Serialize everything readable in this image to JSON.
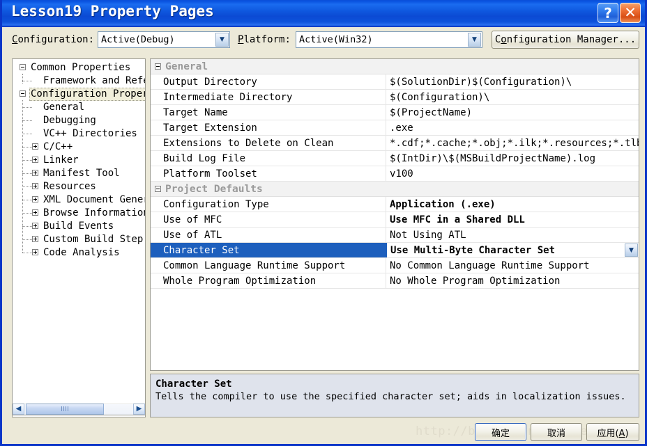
{
  "window": {
    "title": "Lesson19 Property Pages",
    "help_icon": "question-mark-icon",
    "close_icon": "close-x-icon",
    "help_label": "?",
    "close_label": "✕"
  },
  "toolbar": {
    "configuration_label": "Configuration:",
    "configuration_accel": "C",
    "configuration_value": "Active(Debug)",
    "platform_label": "Platform:",
    "platform_accel": "P",
    "platform_value": "Active(Win32)",
    "config_manager_label": "Configuration Manager...",
    "config_manager_accel": "o",
    "dropdown_glyph": "❯"
  },
  "tree": {
    "items": [
      {
        "label": "Common Properties",
        "depth": 0,
        "box": "minus",
        "selected": false
      },
      {
        "label": "Framework and References",
        "depth": 1,
        "box": "none",
        "selected": false
      },
      {
        "label": "Configuration Properties",
        "depth": 0,
        "box": "minus",
        "selected": true
      },
      {
        "label": "General",
        "depth": 1,
        "box": "none",
        "selected": false
      },
      {
        "label": "Debugging",
        "depth": 1,
        "box": "none",
        "selected": false
      },
      {
        "label": "VC++ Directories",
        "depth": 1,
        "box": "none",
        "selected": false
      },
      {
        "label": "C/C++",
        "depth": 1,
        "box": "plus",
        "selected": false
      },
      {
        "label": "Linker",
        "depth": 1,
        "box": "plus",
        "selected": false
      },
      {
        "label": "Manifest Tool",
        "depth": 1,
        "box": "plus",
        "selected": false
      },
      {
        "label": "Resources",
        "depth": 1,
        "box": "plus",
        "selected": false
      },
      {
        "label": "XML Document Generator",
        "depth": 1,
        "box": "plus",
        "selected": false
      },
      {
        "label": "Browse Information",
        "depth": 1,
        "box": "plus",
        "selected": false
      },
      {
        "label": "Build Events",
        "depth": 1,
        "box": "plus",
        "selected": false
      },
      {
        "label": "Custom Build Step",
        "depth": 1,
        "box": "plus",
        "selected": false
      },
      {
        "label": "Code Analysis",
        "depth": 1,
        "box": "plus",
        "selected": false
      }
    ],
    "scrollbar": {
      "left_arrow": "❮",
      "right_arrow": "❯"
    }
  },
  "grid": {
    "sections": [
      {
        "name": "General",
        "collapsed": false,
        "rows": [
          {
            "name": "Output Directory",
            "value": "$(SolutionDir)$(Configuration)\\",
            "bold": false,
            "selected": false
          },
          {
            "name": "Intermediate Directory",
            "value": "$(Configuration)\\",
            "bold": false,
            "selected": false
          },
          {
            "name": "Target Name",
            "value": "$(ProjectName)",
            "bold": false,
            "selected": false
          },
          {
            "name": "Target Extension",
            "value": ".exe",
            "bold": false,
            "selected": false
          },
          {
            "name": "Extensions to Delete on Clean",
            "value": "*.cdf;*.cache;*.obj;*.ilk;*.resources;*.tlb;*",
            "bold": false,
            "selected": false
          },
          {
            "name": "Build Log File",
            "value": "$(IntDir)\\$(MSBuildProjectName).log",
            "bold": false,
            "selected": false
          },
          {
            "name": "Platform Toolset",
            "value": "v100",
            "bold": false,
            "selected": false
          }
        ]
      },
      {
        "name": "Project Defaults",
        "collapsed": false,
        "rows": [
          {
            "name": "Configuration Type",
            "value": "Application (.exe)",
            "bold": true,
            "selected": false
          },
          {
            "name": "Use of MFC",
            "value": "Use MFC in a Shared DLL",
            "bold": true,
            "selected": false
          },
          {
            "name": "Use of ATL",
            "value": "Not Using ATL",
            "bold": false,
            "selected": false
          },
          {
            "name": "Character Set",
            "value": "Use Multi-Byte Character Set",
            "bold": true,
            "selected": true
          },
          {
            "name": "Common Language Runtime Support",
            "value": "No Common Language Runtime Support",
            "bold": false,
            "selected": false
          },
          {
            "name": "Whole Program Optimization",
            "value": "No Whole Program Optimization",
            "bold": false,
            "selected": false
          }
        ]
      }
    ],
    "value_dropdown_glyph": "❯"
  },
  "description": {
    "title": "Character Set",
    "text": "Tells the compiler to use the specified character set; aids in localization issues."
  },
  "footer": {
    "watermark": "http://blog.csdn.net/benkaoya",
    "ok_label": "确定",
    "cancel_label": "取消",
    "apply_label": "应用(A)",
    "apply_accel": "A"
  },
  "colors": {
    "titlebar_blue": "#0b55e2",
    "selection_blue": "#1d5fbd",
    "dialog_face": "#ece9d8",
    "description_bg": "#dfe3ec",
    "close_orange": "#ef7136"
  }
}
